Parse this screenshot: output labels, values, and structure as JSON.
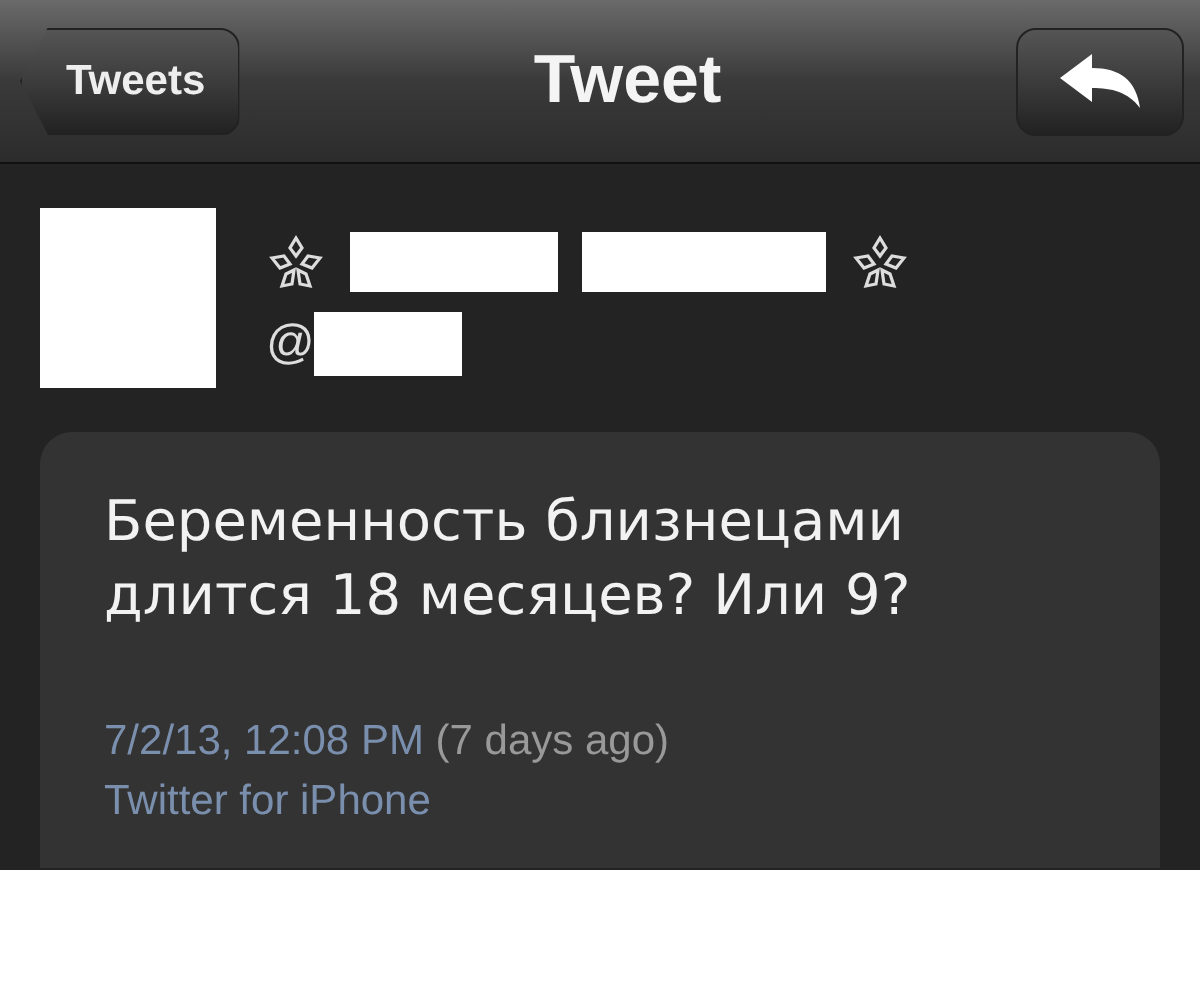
{
  "nav_bar": {
    "back_button": "Tweets",
    "title": "Tweet"
  },
  "author": {
    "handle_prefix": "@"
  },
  "tweet": {
    "text": "Беременность близнецами\nдлится 18 месяцев? Или 9?",
    "date": "7/2/13, 12:08 PM",
    "age": "(7 days ago)",
    "source": "Twitter for iPhone"
  }
}
